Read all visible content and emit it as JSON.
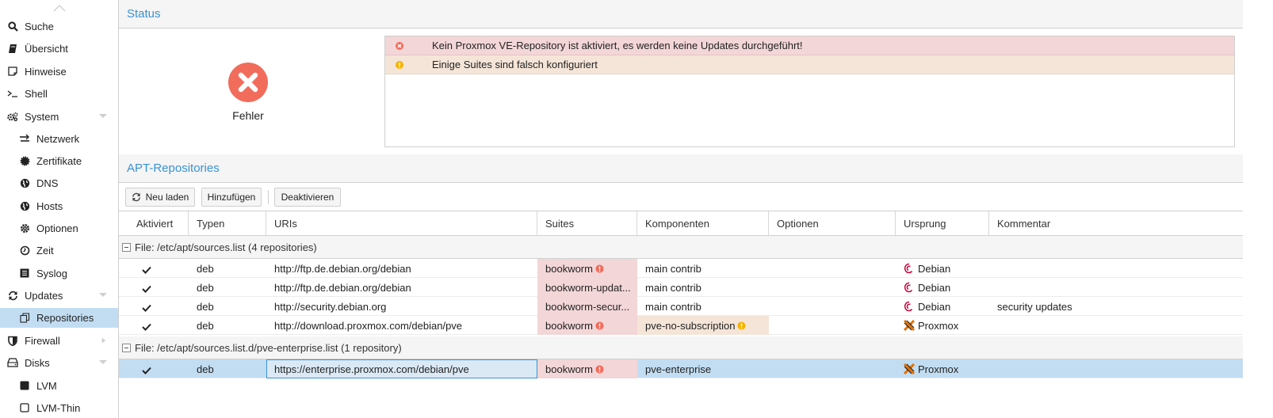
{
  "colors": {
    "accent": "#3892d4",
    "error": "#f26c5b",
    "warning": "#f4b400",
    "selected": "#c2ddf2",
    "error_bg": "#f3d6d7",
    "warning_bg": "#f5e5d8",
    "debian": "#c70036",
    "proxmox_orange": "#e57000"
  },
  "sidebar": {
    "items": [
      {
        "label": "Suche",
        "icon": "search-icon"
      },
      {
        "label": "Übersicht",
        "icon": "book-icon"
      },
      {
        "label": "Hinweise",
        "icon": "note-icon"
      },
      {
        "label": "Shell",
        "icon": "terminal-icon"
      },
      {
        "label": "System",
        "icon": "cogs-icon"
      },
      {
        "label": "Netzwerk",
        "icon": "exchange-icon"
      },
      {
        "label": "Zertifikate",
        "icon": "certificate-icon"
      },
      {
        "label": "DNS",
        "icon": "globe-icon"
      },
      {
        "label": "Hosts",
        "icon": "globe-icon"
      },
      {
        "label": "Optionen",
        "icon": "gear-icon"
      },
      {
        "label": "Zeit",
        "icon": "clock-icon"
      },
      {
        "label": "Syslog",
        "icon": "list-icon"
      },
      {
        "label": "Updates",
        "icon": "refresh-icon"
      },
      {
        "label": "Repositories",
        "icon": "files-icon"
      },
      {
        "label": "Firewall",
        "icon": "shield-icon"
      },
      {
        "label": "Disks",
        "icon": "hdd-icon"
      },
      {
        "label": "LVM",
        "icon": "square-icon"
      },
      {
        "label": "LVM-Thin",
        "icon": "square-outline-icon"
      }
    ]
  },
  "status": {
    "title": "Status",
    "overall": "Fehler",
    "messages": [
      {
        "level": "error",
        "text": "Kein Proxmox VE-Repository ist aktiviert, es werden keine Updates durchgeführt!"
      },
      {
        "level": "warning",
        "text": "Einige Suites sind falsch konfiguriert"
      }
    ]
  },
  "apt": {
    "title": "APT-Repositories",
    "toolbar": {
      "reload": "Neu laden",
      "add": "Hinzufügen",
      "disable": "Deaktivieren"
    },
    "columns": [
      "Aktiviert",
      "Typen",
      "URIs",
      "Suites",
      "Komponenten",
      "Optionen",
      "Ursprung",
      "Kommentar"
    ],
    "groups": [
      {
        "label": "File: /etc/apt/sources.list (4 repositories)",
        "rows": [
          {
            "types": "deb",
            "uri": "http://ftp.de.debian.org/debian",
            "suite": "bookworm",
            "suite_warn": true,
            "components": "main contrib",
            "components_warn": false,
            "options": "",
            "origin": "Debian",
            "comment": ""
          },
          {
            "types": "deb",
            "uri": "http://ftp.de.debian.org/debian",
            "suite": "bookworm-updat...",
            "suite_warn": true,
            "components": "main contrib",
            "components_warn": false,
            "options": "",
            "origin": "Debian",
            "comment": ""
          },
          {
            "types": "deb",
            "uri": "http://security.debian.org",
            "suite": "bookworm-secur...",
            "suite_warn": true,
            "components": "main contrib",
            "components_warn": false,
            "options": "",
            "origin": "Debian",
            "comment": "security updates"
          },
          {
            "types": "deb",
            "uri": "http://download.proxmox.com/debian/pve",
            "suite": "bookworm",
            "suite_warn": true,
            "components": "pve-no-subscription",
            "components_warn": true,
            "options": "",
            "origin": "Proxmox",
            "comment": ""
          }
        ]
      },
      {
        "label": "File: /etc/apt/sources.list.d/pve-enterprise.list (1 repository)",
        "rows": [
          {
            "types": "deb",
            "uri": "https://enterprise.proxmox.com/debian/pve",
            "suite": "bookworm",
            "suite_warn": true,
            "components": "pve-enterprise",
            "components_warn": false,
            "options": "",
            "origin": "Proxmox",
            "comment": ""
          }
        ]
      }
    ]
  }
}
